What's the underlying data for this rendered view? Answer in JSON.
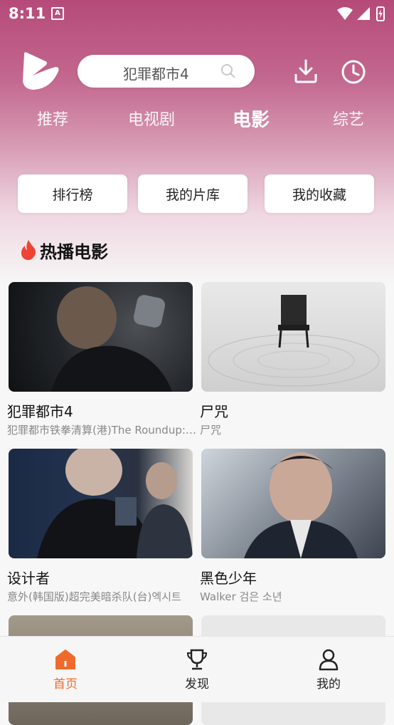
{
  "status_bar": {
    "time": "8:11",
    "a_badge": "A"
  },
  "header": {
    "search_placeholder": "犯罪都市4",
    "icons": [
      "logo",
      "search-icon",
      "download-icon",
      "history-icon"
    ]
  },
  "tabs": [
    {
      "label": "推荐",
      "active": false
    },
    {
      "label": "电视剧",
      "active": false
    },
    {
      "label": "电影",
      "active": true
    },
    {
      "label": "综艺",
      "active": false
    }
  ],
  "quick_buttons": [
    {
      "label": "排行榜"
    },
    {
      "label": "我的片库"
    },
    {
      "label": "我的收藏"
    }
  ],
  "section": {
    "title": "热播电影",
    "icon": "flame-icon"
  },
  "movies": [
    {
      "title": "犯罪都市4",
      "subtitle": "犯罪都市铁拳清算(港)The Roundup: Punishment"
    },
    {
      "title": "尸咒",
      "subtitle": "尸咒"
    },
    {
      "title": "设计者",
      "subtitle": "意外(韩国版)超完美暗杀队(台)엑시트"
    },
    {
      "title": "黑色少年",
      "subtitle": "Walker 검은 소년"
    },
    {
      "title": "",
      "subtitle": ""
    },
    {
      "title": "",
      "subtitle": ""
    }
  ],
  "bottom_nav": [
    {
      "label": "首页",
      "active": true,
      "icon": "home-icon"
    },
    {
      "label": "发现",
      "active": false,
      "icon": "trophy-icon"
    },
    {
      "label": "我的",
      "active": false,
      "icon": "user-icon"
    }
  ],
  "colors": {
    "accent": "#f06a2d",
    "header_top": "#b54a79"
  }
}
